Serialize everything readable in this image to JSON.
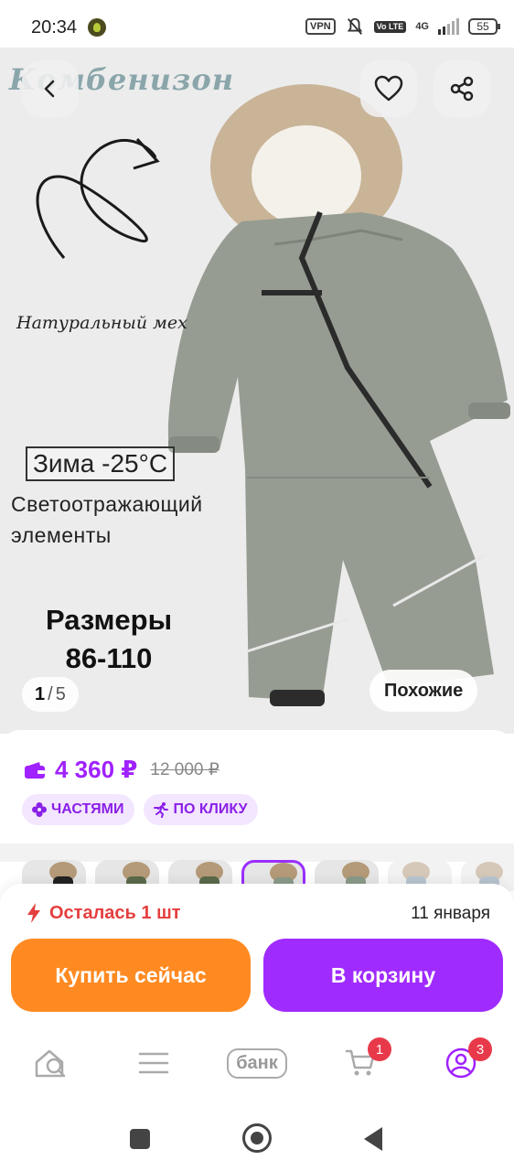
{
  "status_bar": {
    "time": "20:34",
    "vpn": "VPN",
    "volte": "Vo LTE",
    "network": "4G",
    "battery": "55"
  },
  "hero": {
    "title": "Комбенизон",
    "fur_caption": "Натуральный мех",
    "winter_caption": "Зима -25°C",
    "reflective_caption": "Светоотражающий элементы",
    "sizes_label": "Размеры",
    "sizes_value": "86-110",
    "counter_current": "1",
    "counter_total": "5",
    "similar_label": "Похожие"
  },
  "price": {
    "current": "4 360 ₽",
    "old": "12 000 ₽",
    "chip_installments": "ЧАСТЯМИ",
    "chip_oneclick": "ПО КЛИКУ",
    "accent_color": "#a022ff"
  },
  "buy_panel": {
    "stock": "Осталась 1 шт",
    "delivery_date": "11 января",
    "buy_now": "Купить сейчас",
    "add_to_cart": "В корзину",
    "buy_color": "#ff8a22",
    "cart_color": "#a02bff"
  },
  "bottom_nav": {
    "bank_label": "банк",
    "cart_badge": "1",
    "profile_badge": "3"
  },
  "icons": [
    "back-icon",
    "heart-icon",
    "share-icon",
    "wallet-icon",
    "installments-icon",
    "runner-icon",
    "lightning-icon",
    "home-search-icon",
    "menu-icon",
    "cart-icon",
    "profile-icon"
  ]
}
